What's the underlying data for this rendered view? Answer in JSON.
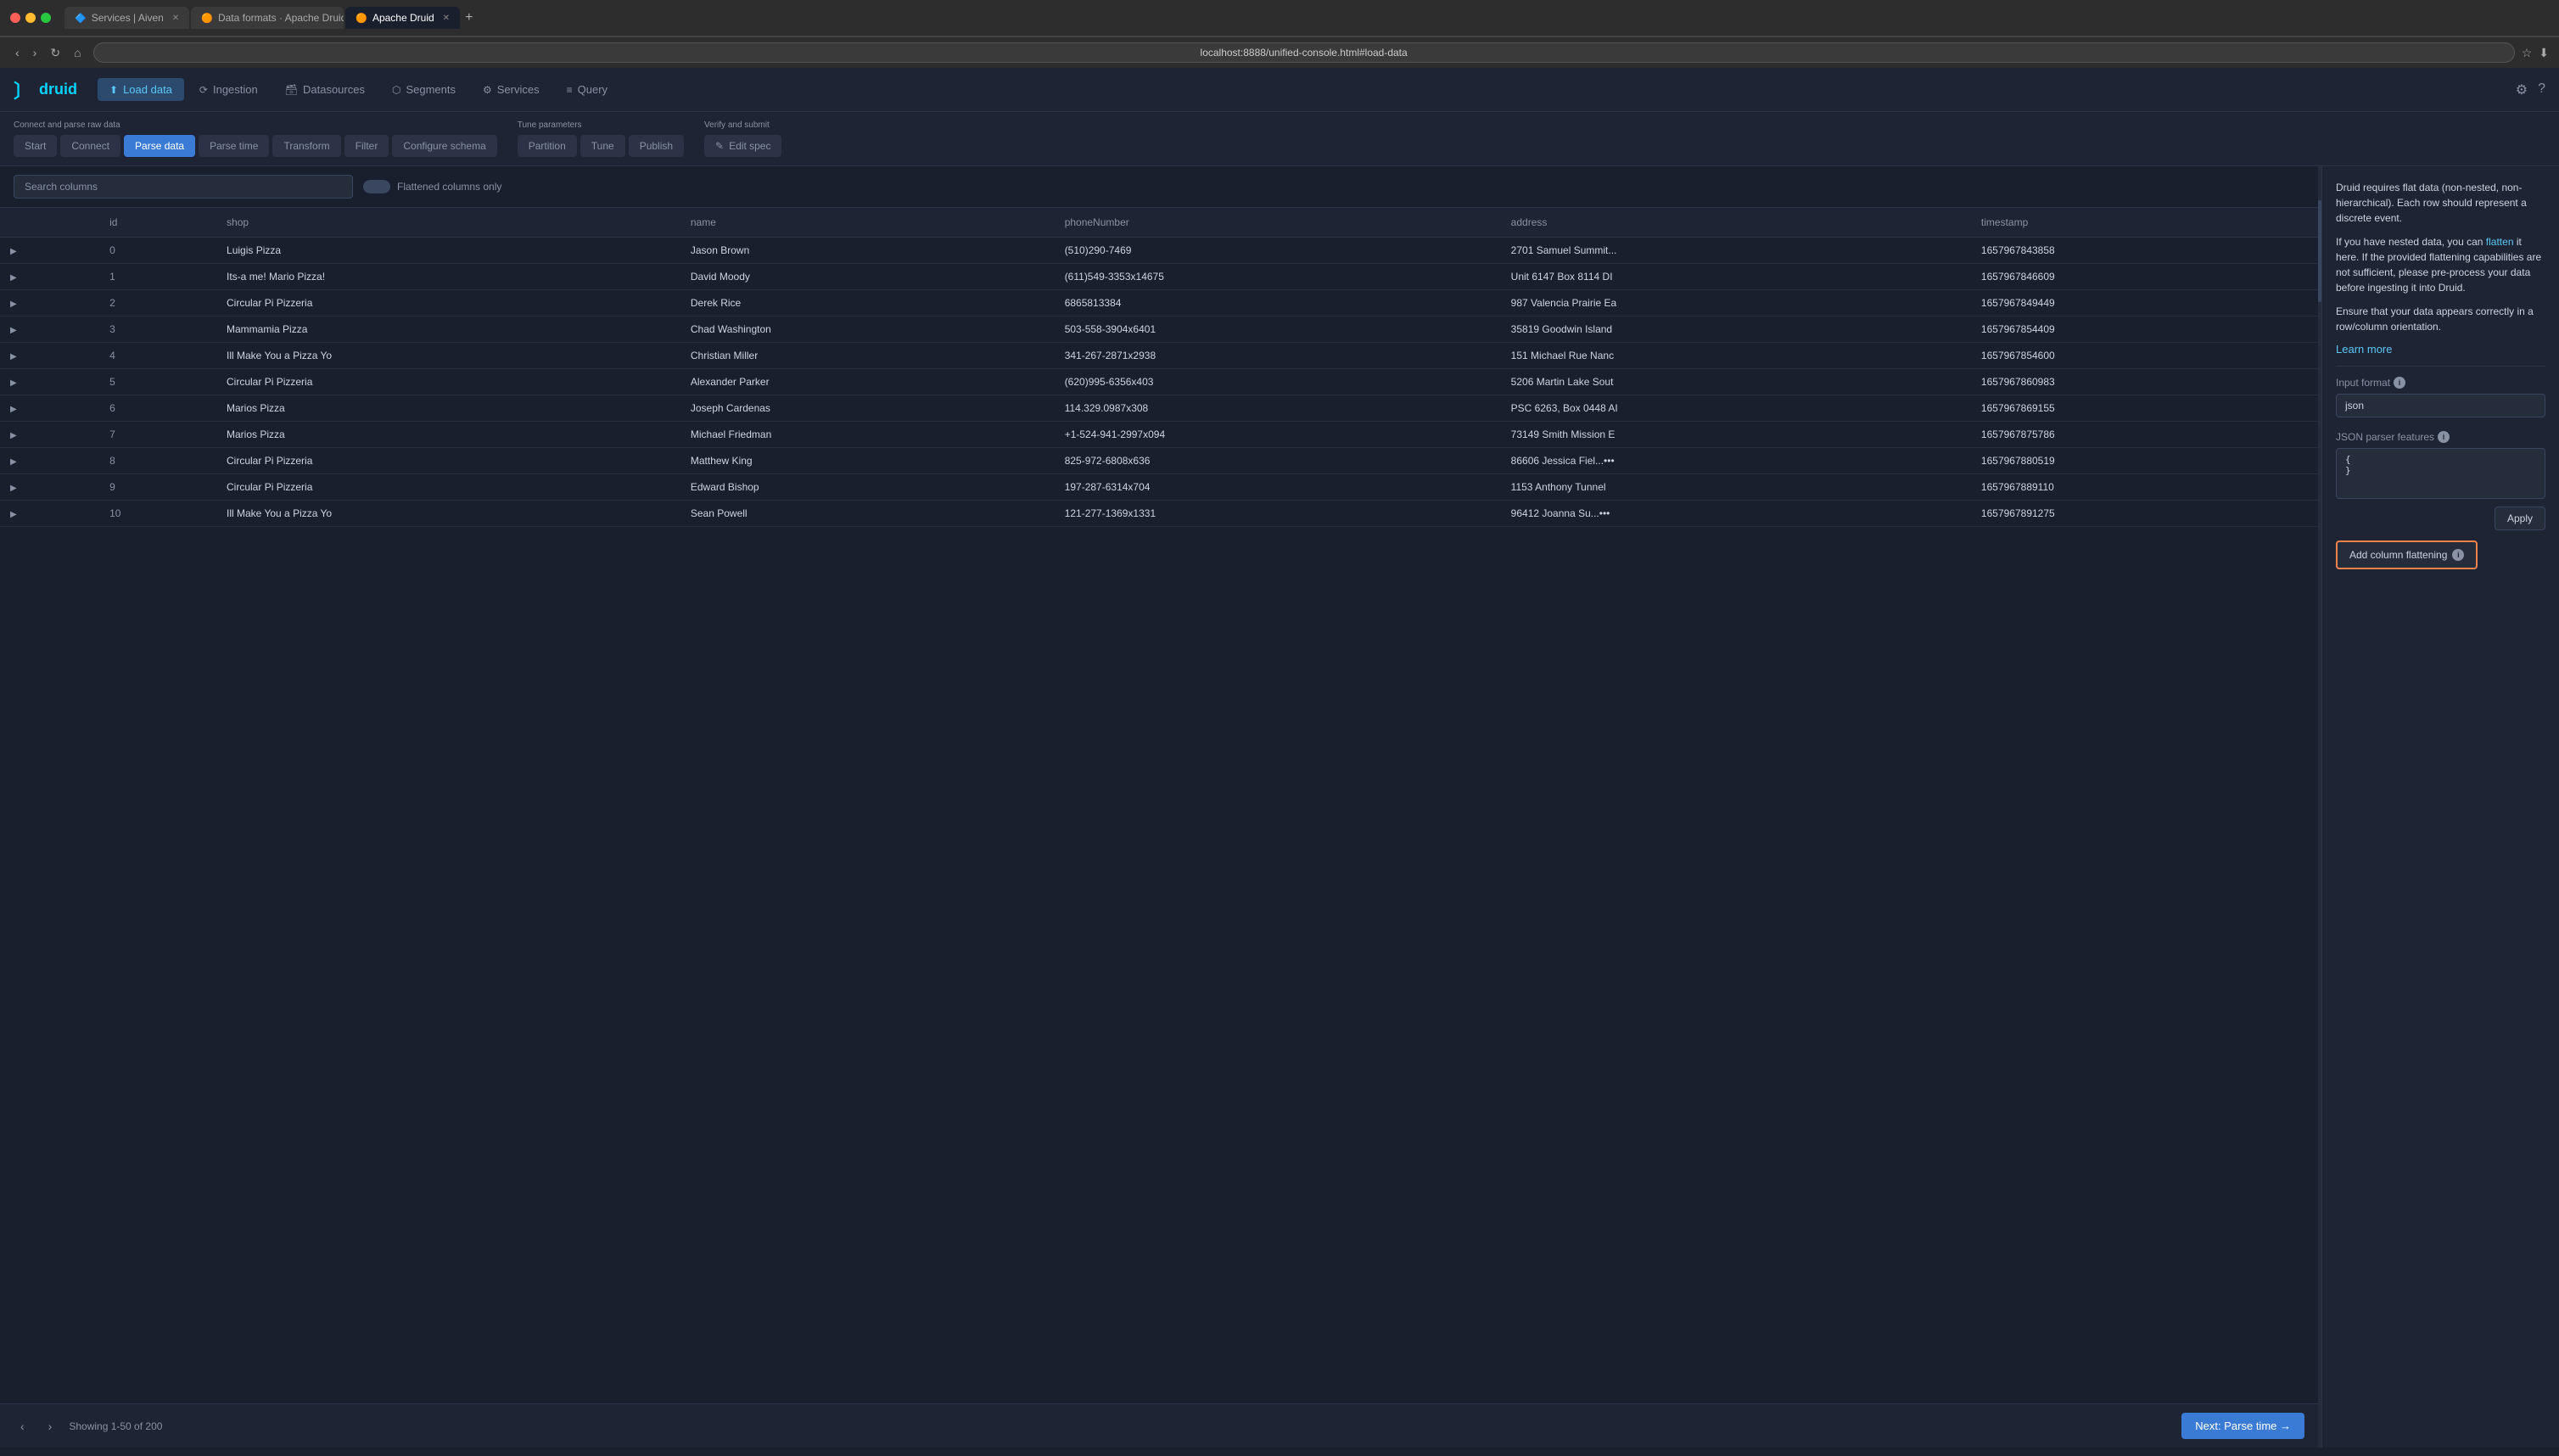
{
  "browser": {
    "tabs": [
      {
        "id": "services",
        "label": "Services | Aiven",
        "icon": "🔷",
        "active": false
      },
      {
        "id": "data-formats",
        "label": "Data formats · Apache Druid",
        "icon": "🟠",
        "active": false
      },
      {
        "id": "apache-druid",
        "label": "Apache Druid",
        "icon": "🟠",
        "active": true
      }
    ],
    "url": "localhost:8888/unified-console.html#load-data",
    "new_tab_label": "+"
  },
  "topbar": {
    "logo_text": "druid",
    "nav_items": [
      {
        "id": "load-data",
        "label": "Load data",
        "icon": "⬆",
        "active": true
      },
      {
        "id": "ingestion",
        "label": "Ingestion",
        "icon": "⟳",
        "active": false
      },
      {
        "id": "datasources",
        "label": "Datasources",
        "icon": "🗃",
        "active": false
      },
      {
        "id": "segments",
        "label": "Segments",
        "icon": "⬡",
        "active": false
      },
      {
        "id": "services",
        "label": "Services",
        "icon": "⚙",
        "active": false
      },
      {
        "id": "query",
        "label": "Query",
        "icon": "≡",
        "active": false
      }
    ],
    "settings_icon": "⚙",
    "help_icon": "?"
  },
  "wizard": {
    "sections": [
      {
        "label": "Connect and parse raw data",
        "steps": [
          {
            "id": "start",
            "label": "Start",
            "active": false
          },
          {
            "id": "connect",
            "label": "Connect",
            "active": false
          },
          {
            "id": "parse-data",
            "label": "Parse data",
            "active": true
          },
          {
            "id": "parse-time",
            "label": "Parse time",
            "active": false
          },
          {
            "id": "transform",
            "label": "Transform",
            "active": false
          },
          {
            "id": "filter",
            "label": "Filter",
            "active": false
          },
          {
            "id": "configure-schema",
            "label": "Configure schema",
            "active": false
          }
        ]
      },
      {
        "label": "Tune parameters",
        "steps": [
          {
            "id": "partition",
            "label": "Partition",
            "active": false
          },
          {
            "id": "tune",
            "label": "Tune",
            "active": false
          },
          {
            "id": "publish",
            "label": "Publish",
            "active": false
          }
        ]
      },
      {
        "label": "Verify and submit",
        "steps": [
          {
            "id": "edit-spec",
            "label": "Edit spec",
            "active": false,
            "icon": "✎"
          }
        ]
      }
    ]
  },
  "search": {
    "placeholder": "Search columns",
    "flattened_label": "Flattened columns only"
  },
  "table": {
    "columns": [
      "",
      "id",
      "shop",
      "name",
      "phoneNumber",
      "address",
      "timestamp"
    ],
    "rows": [
      {
        "expand": "▶",
        "id": "0",
        "shop": "Luigis Pizza",
        "name": "Jason Brown",
        "phoneNumber": "(510)290-7469",
        "address": "2701 Samuel Summit...",
        "timestamp": "1657967843858"
      },
      {
        "expand": "▶",
        "id": "1",
        "shop": "Its-a me! Mario Pizza!",
        "name": "David Moody",
        "phoneNumber": "(611)549-3353x14675",
        "address": "Unit 6147 Box 8114 DI",
        "timestamp": "1657967846609"
      },
      {
        "expand": "▶",
        "id": "2",
        "shop": "Circular Pi Pizzeria",
        "name": "Derek Rice",
        "phoneNumber": "6865813384",
        "address": "987 Valencia Prairie Ea",
        "timestamp": "1657967849449"
      },
      {
        "expand": "▶",
        "id": "3",
        "shop": "Mammamia Pizza",
        "name": "Chad Washington",
        "phoneNumber": "503-558-3904x6401",
        "address": "35819 Goodwin Island",
        "timestamp": "1657967854409"
      },
      {
        "expand": "▶",
        "id": "4",
        "shop": "Ill Make You a Pizza Yo",
        "name": "Christian Miller",
        "phoneNumber": "341-267-2871x2938",
        "address": "151 Michael Rue Nanc",
        "timestamp": "1657967854600"
      },
      {
        "expand": "▶",
        "id": "5",
        "shop": "Circular Pi Pizzeria",
        "name": "Alexander Parker",
        "phoneNumber": "(620)995-6356x403",
        "address": "5206 Martin Lake Sout",
        "timestamp": "1657967860983"
      },
      {
        "expand": "▶",
        "id": "6",
        "shop": "Marios Pizza",
        "name": "Joseph Cardenas",
        "phoneNumber": "114.329.0987x308",
        "address": "PSC 6263, Box 0448 AI",
        "timestamp": "1657967869155"
      },
      {
        "expand": "▶",
        "id": "7",
        "shop": "Marios Pizza",
        "name": "Michael Friedman",
        "phoneNumber": "+1-524-941-2997x094",
        "address": "73149 Smith Mission E",
        "timestamp": "1657967875786"
      },
      {
        "expand": "▶",
        "id": "8",
        "shop": "Circular Pi Pizzeria",
        "name": "Matthew King",
        "phoneNumber": "825-972-6808x636",
        "address": "86606 Jessica Fiel...•••",
        "timestamp": "1657967880519"
      },
      {
        "expand": "▶",
        "id": "9",
        "shop": "Circular Pi Pizzeria",
        "name": "Edward Bishop",
        "phoneNumber": "197-287-6314x704",
        "address": "1153 Anthony Tunnel",
        "timestamp": "1657967889110"
      },
      {
        "expand": "▶",
        "id": "10",
        "shop": "Ill Make You a Pizza Yo",
        "name": "Sean Powell",
        "phoneNumber": "121-277-1369x1331",
        "address": "96412 Joanna Su...•••",
        "timestamp": "1657967891275"
      }
    ]
  },
  "pagination": {
    "prev_icon": "‹",
    "next_icon": "›",
    "info": "Showing 1-50 of 200",
    "next_button": "Next: Parse time →"
  },
  "right_panel": {
    "description_parts": [
      "Druid requires flat data (non-nested, non-hierarchical). Each row should represent a discrete event.",
      "If you have nested data, you can ",
      "flatten",
      " it here. If the provided flattening capabilities are not sufficient, please pre-process your data before ingesting it into Druid.",
      "Ensure that your data appears correctly in a row/column orientation."
    ],
    "learn_more_label": "Learn more",
    "input_format_label": "Input format",
    "input_format_value": "json",
    "json_parser_label": "JSON parser features",
    "json_open": "{",
    "json_close": "}",
    "apply_label": "Apply",
    "add_column_flattening_label": "Add column flattening",
    "info_icon_label": "ℹ"
  }
}
